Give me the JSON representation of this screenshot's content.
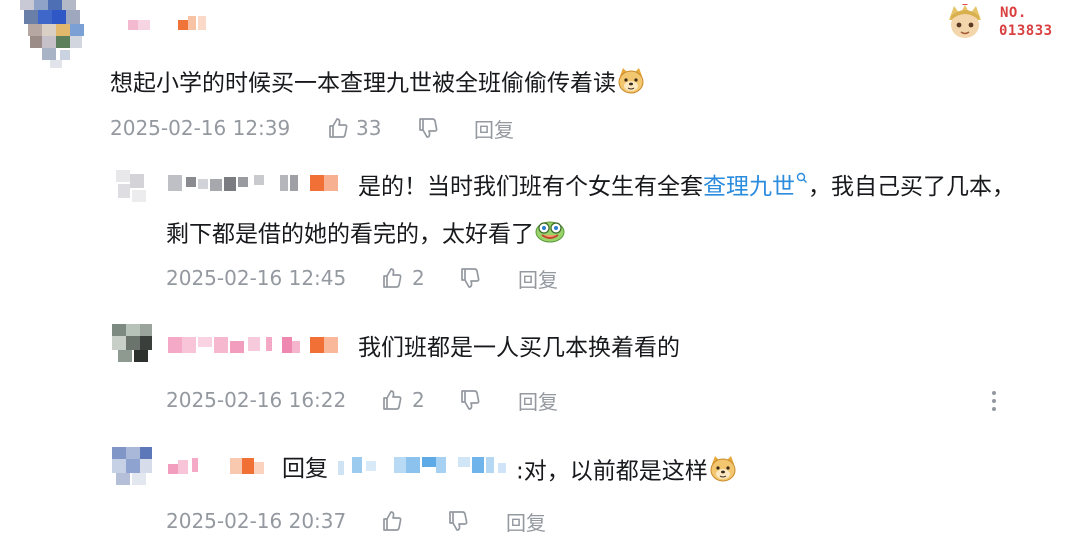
{
  "badge": {
    "label": "NO.",
    "number": "013833"
  },
  "comments": [
    {
      "text": "想起小学的时候买一本查理九世被全班偷偷传着读",
      "time": "2025-02-16 12:39",
      "likes": "33",
      "reply_label": "回复"
    },
    {
      "text_line1_before": "是的！当时我们班有个女生有全套",
      "text_link": "查理九世",
      "text_line1_after": "，我自己买了几本，",
      "text_line2": "剩下都是借的她的看完的，太好看了",
      "time": "2025-02-16 12:45",
      "likes": "2",
      "reply_label": "回复"
    },
    {
      "text": "我们班都是一人买几本换着看的",
      "time": "2025-02-16 16:22",
      "likes": "2",
      "reply_label": "回复"
    },
    {
      "reply_prefix": "回复",
      "text": ":对，以前都是这样",
      "time": "2025-02-16 20:37",
      "reply_label": "回复"
    }
  ],
  "colors": {
    "text": "#18191c",
    "meta": "#9499a0",
    "link": "#2b8cde",
    "badge": "#d93f3f"
  },
  "icons": [
    "like-icon",
    "dislike-icon",
    "search-icon",
    "more-icon",
    "doge-emoji",
    "laugh-emoji"
  ]
}
